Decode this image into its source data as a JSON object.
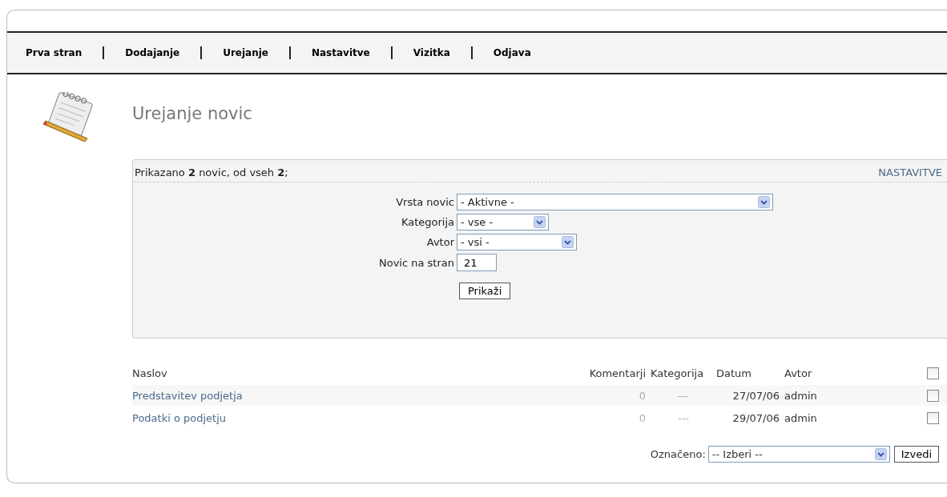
{
  "nav": [
    {
      "label": "Prva stran"
    },
    {
      "label": "Dodajanje"
    },
    {
      "label": "Urejanje"
    },
    {
      "label": "Nastavitve"
    },
    {
      "label": "Vizitka"
    },
    {
      "label": "Odjava"
    }
  ],
  "page_title": "Urejanje novic",
  "filter": {
    "summary": "Prikazano **2** novic, od vseh **2**;",
    "settings_link": "NASTAVITVE",
    "fields": [
      {
        "kind": "select",
        "label": "Vrsta novic",
        "value": "- Aktivne -"
      },
      {
        "kind": "select",
        "label": "Kategorija",
        "value": "- vse -"
      },
      {
        "kind": "select",
        "label": "Avtor",
        "value": "- vsi -"
      },
      {
        "kind": "input",
        "label": "Novic na stran",
        "value": "21"
      }
    ],
    "submit": "Prikaži"
  },
  "table": {
    "columns": [
      "Naslov",
      "Komentarji",
      "Kategorija",
      "Datum",
      "Avtor"
    ],
    "select_all_checked": false,
    "rows": [
      {
        "title": "Predstavitev podjetja",
        "comments": "0",
        "category": "---",
        "date": "27/07/06",
        "author": "admin",
        "checked": false
      },
      {
        "title": "Podatki o podjetju",
        "comments": "0",
        "category": "---",
        "date": "29/07/06",
        "author": "admin",
        "checked": false
      }
    ]
  },
  "bulk": {
    "label": "Označeno:",
    "select": "-- Izberi --",
    "button": "Izvedi"
  }
}
